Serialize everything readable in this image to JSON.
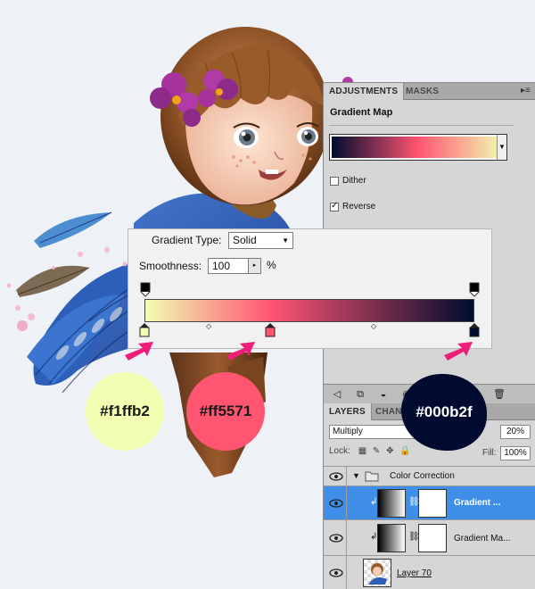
{
  "adjustments": {
    "tabs": [
      {
        "label": "ADJUSTMENTS"
      },
      {
        "label": "MASKS"
      }
    ],
    "title": "Gradient Map",
    "dither_label": "Dither",
    "reverse_label": "Reverse",
    "dither_checked": false,
    "reverse_checked": true,
    "gradient_colors": [
      "#000b2f",
      "#ff5571",
      "#f1ffb2"
    ]
  },
  "gradient_editor": {
    "type_label": "Gradient Type:",
    "type_value": "Solid",
    "smoothness_label": "Smoothness:",
    "smoothness_value": "100",
    "smoothness_unit": "%",
    "color_stops": [
      {
        "color": "#f1ffb2",
        "location": 0
      },
      {
        "color": "#ff5571",
        "location": 38
      },
      {
        "color": "#000b2f",
        "location": 100
      }
    ]
  },
  "swatches": [
    {
      "hex": "#f1ffb2",
      "label": "#f1ffb2",
      "text_color": "#1a1a1a"
    },
    {
      "hex": "#ff5571",
      "label": "#ff5571",
      "text_color": "#1a1a1a"
    },
    {
      "hex": "#000b2f",
      "label": "#000b2f",
      "text_color": "#ffffff"
    }
  ],
  "layers": {
    "tabs": [
      {
        "label": "LAYERS"
      },
      {
        "label": "CHANN"
      }
    ],
    "blend_mode": "Multiply",
    "opacity": "20%",
    "lock_label": "Lock:",
    "fill_label": "Fill:",
    "fill_value": "100%",
    "items": [
      {
        "name": "Color Correction",
        "kind": "group",
        "selected": false
      },
      {
        "name": "Gradient ...",
        "kind": "adjustment",
        "selected": true
      },
      {
        "name": "Gradient Ma...",
        "kind": "adjustment",
        "selected": false
      },
      {
        "name": "Layer 70",
        "kind": "pixel",
        "selected": false
      }
    ]
  },
  "accent_colors": {
    "arrow": "#ee1e79",
    "selection": "#3f8fe8"
  }
}
